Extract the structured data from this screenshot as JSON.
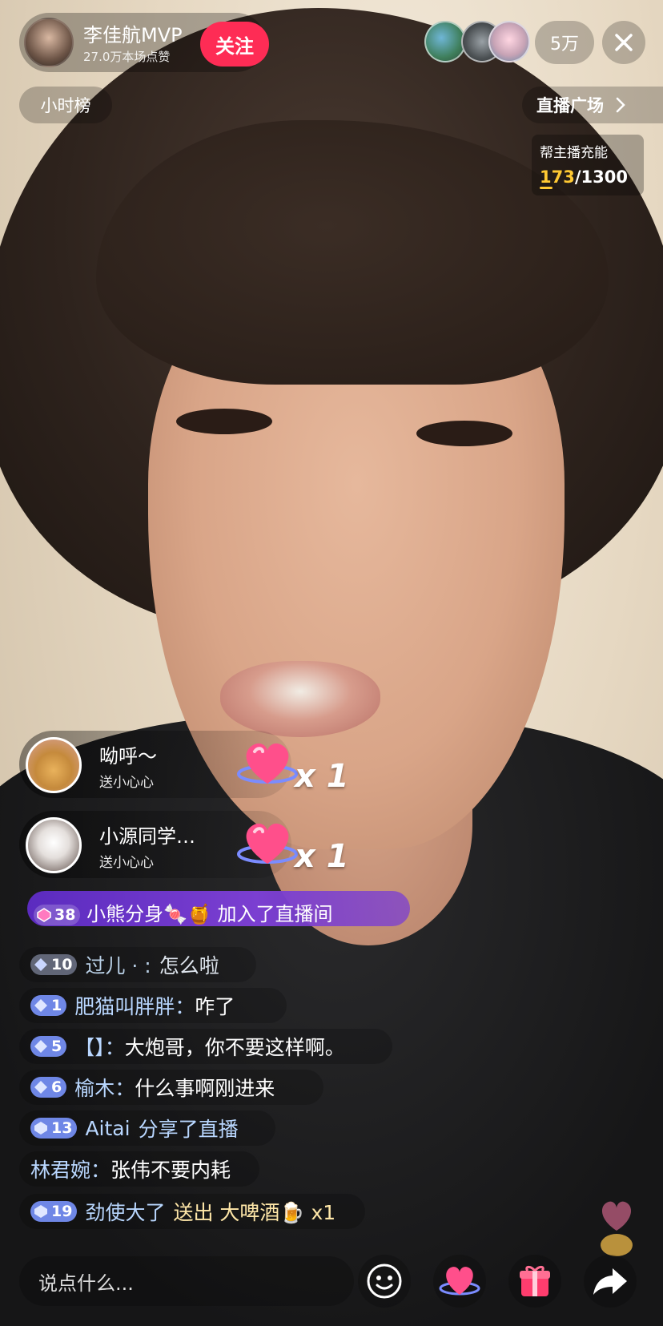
{
  "host": {
    "name": "李佳航MVP",
    "likes": "27.0万本场点赞",
    "follow_label": "关注"
  },
  "viewers": {
    "count": "5万"
  },
  "nav": {
    "hour_rank": "小时榜",
    "plaza": "直播广场"
  },
  "energy": {
    "label": "帮主播充能",
    "current": "173",
    "separator": "/",
    "total": "1300"
  },
  "gifts": [
    {
      "user": "呦呼～",
      "action": "送小心心",
      "count": "x 1"
    },
    {
      "user": "小源同学…",
      "action": "送小心心",
      "count": "x 1"
    }
  ],
  "join": {
    "level": "38",
    "user": "小熊分身🍬🍯",
    "text": "加入了直播间"
  },
  "chat": [
    {
      "level": "10",
      "name": "过儿 · :",
      "msg": "怎么啦"
    },
    {
      "level": "1",
      "name": "肥猫叫胖胖：",
      "msg": "咋了"
    },
    {
      "level": "5",
      "name": "【】：",
      "msg": "大炮哥，你不要这样啊。"
    },
    {
      "level": "6",
      "name": "榆木：",
      "msg": "什么事啊刚进来"
    },
    {
      "level": "13",
      "name": "Aitai",
      "msg": "分享了直播"
    },
    {
      "level": "",
      "name": "林君婉：",
      "msg": "张伟不要内耗"
    },
    {
      "level": "19",
      "name": "劲使大了",
      "msg": "送出 大啤酒🍺 x1"
    }
  ],
  "input": {
    "placeholder": "说点什么..."
  },
  "colors": {
    "follow": "#fe2c55",
    "energy_highlight": "#ffc933",
    "chat_name": "#b9d7ff",
    "join_banner": "#6a34c8"
  }
}
